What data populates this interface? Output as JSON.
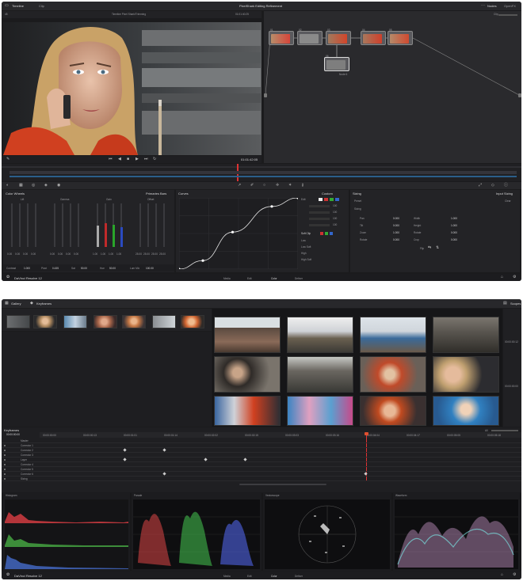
{
  "win1": {
    "header": {
      "left_tab": "Timeline",
      "left_tab2": "Clip",
      "title": "PixelShark Editing Refinement",
      "right_a": "Nodes",
      "right_b": "OpenFX"
    },
    "viewer": {
      "clip_title": "Timeline Pixel Shark/Trimming",
      "tc_top": "01:01:40:25",
      "timecode": "01:01:42:05"
    },
    "nodes": {
      "clip_label": "Clip",
      "node_nums": [
        "01",
        "02",
        "03",
        "04",
        "05",
        "06"
      ],
      "node_label": "Node 6"
    },
    "color_wheels": {
      "title": "Color Wheels",
      "mode": "Primaries Bars",
      "wheels": [
        "Lift",
        "Gamma",
        "Gain",
        "Offset"
      ],
      "values": [
        [
          "0.00",
          "0.00",
          "0.00",
          "0.00"
        ],
        [
          "0.00",
          "0.00",
          "0.00",
          "0.00"
        ],
        [
          "1.00",
          "1.00",
          "1.00",
          "1.00"
        ],
        [
          "25.00",
          "25.00",
          "25.00",
          "25.00"
        ]
      ],
      "footer": [
        {
          "label": "Contrast",
          "value": "1.000"
        },
        {
          "label": "Pivot",
          "value": "0.435"
        },
        {
          "label": "Sat",
          "value": "50.00"
        },
        {
          "label": "Hue",
          "value": "50.00"
        },
        {
          "label": "Lum Mix",
          "value": "100.00"
        }
      ]
    },
    "curves": {
      "title": "Curves",
      "custom_label": "Custom",
      "edit_label": "Edit",
      "channel_values": [
        "100",
        "100",
        "100",
        "100"
      ],
      "soft_clip": "Soft Clip",
      "soft_rows": [
        "Low",
        "Low Soft",
        "High",
        "High Soft"
      ],
      "curve_points": [
        [
          0,
          0
        ],
        [
          0.2,
          0.12
        ],
        [
          0.45,
          0.52
        ],
        [
          0.78,
          0.88
        ],
        [
          1,
          1
        ]
      ]
    },
    "sizing": {
      "title": "Sizing",
      "mode": "Input Sizing",
      "preset_label": "Preset",
      "preset_value": "Clear",
      "group_label": "Sizing",
      "rows": [
        {
          "label": "Pan",
          "value": "0.000",
          "label2": "Width",
          "value2": "1.000"
        },
        {
          "label": "Tilt",
          "value": "0.000",
          "label2": "Height",
          "value2": "1.000"
        },
        {
          "label": "Zoom",
          "value": "1.000",
          "label2": "Rotate",
          "value2": "0.000"
        },
        {
          "label": "Rotate",
          "value": "0.000",
          "label2": "Crop",
          "value2": "0.000"
        }
      ],
      "flip_label": "Flip"
    },
    "pages": [
      "Media",
      "Edit",
      "Color",
      "Deliver"
    ],
    "active_page": "Color",
    "app_name": "DaVinci Resolve 12"
  },
  "win2": {
    "header": {
      "tab_gallery": "Gallery",
      "tab_keyframes": "Keyframes",
      "right_label": "Scopes"
    },
    "keyframes": {
      "title": "Keyframes",
      "tc": "00:00:00:00",
      "ruler": [
        "00:00:00:00",
        "00:00:00:13",
        "00:00:01:01",
        "00:00:01:14",
        "00:00:02:02",
        "00:00:02:15",
        "00:00:03:03",
        "00:00:03:16",
        "00:00:04:04",
        "00:00:04:17",
        "00:00:05:05",
        "00:00:05:18"
      ],
      "all_label": "All",
      "tracks": [
        "Master",
        "Corrector 1",
        "Corrector 2",
        "Corrector 3",
        "Layer",
        "Corrector 4",
        "Corrector 5",
        "Corrector 6",
        "Sizing"
      ]
    },
    "scopes": {
      "titles": [
        "Histogram",
        "Parade",
        "Vectorscope",
        "Waveform"
      ]
    },
    "side_values": [
      "00:00:00:12",
      "00:00:00:00"
    ],
    "pages": [
      "Media",
      "Edit",
      "Color",
      "Deliver"
    ],
    "app_name": "DaVinci Resolve 12"
  }
}
